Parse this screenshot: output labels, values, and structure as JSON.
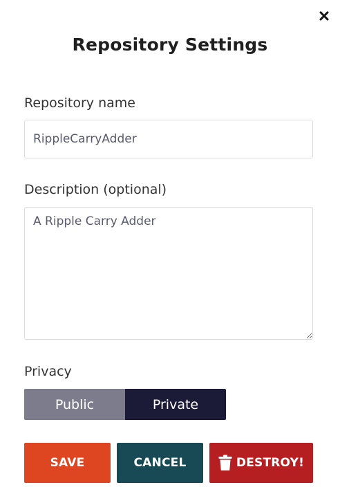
{
  "dialog": {
    "title": "Repository Settings",
    "close_icon": "close-icon"
  },
  "form": {
    "name_label": "Repository name",
    "name_value": "RippleCarryAdder",
    "description_label": "Description (optional)",
    "description_value": "A Ripple Carry Adder",
    "privacy_label": "Privacy",
    "privacy_options": [
      "Public",
      "Private"
    ],
    "privacy_selected": "Private"
  },
  "actions": {
    "save_label": "SAVE",
    "cancel_label": "CANCEL",
    "destroy_label": "DESTROY!",
    "destroy_icon": "trash-icon"
  },
  "colors": {
    "save": "#de4521",
    "cancel": "#184a55",
    "destroy": "#b51f22",
    "privacy_public": "#7c7c8c",
    "privacy_private": "#1b1a37"
  }
}
